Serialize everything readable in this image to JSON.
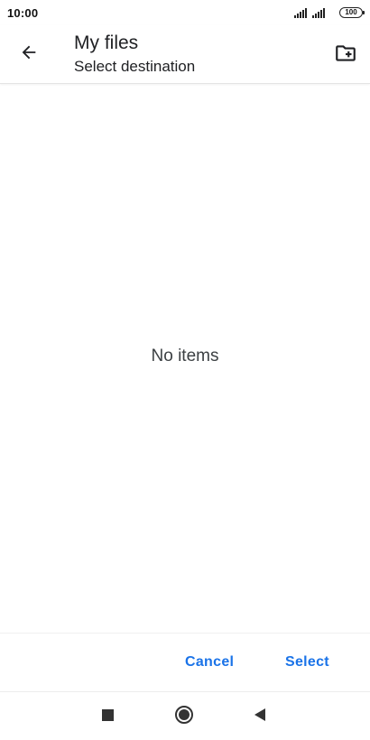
{
  "status_bar": {
    "time": "10:00",
    "battery": "100",
    "icons": [
      "signal-icon",
      "signal-icon",
      "battery-icon"
    ]
  },
  "app_bar": {
    "title": "My files",
    "subtitle": "Select destination",
    "back_icon": "arrow-back-icon",
    "new_folder_icon": "create-new-folder-icon"
  },
  "content": {
    "empty_message": "No items"
  },
  "actions": {
    "cancel_label": "Cancel",
    "select_label": "Select",
    "accent_color": "#1a73e8"
  },
  "nav_bar": {
    "icons": [
      "recents-square-icon",
      "home-circle-icon",
      "back-triangle-icon"
    ]
  }
}
